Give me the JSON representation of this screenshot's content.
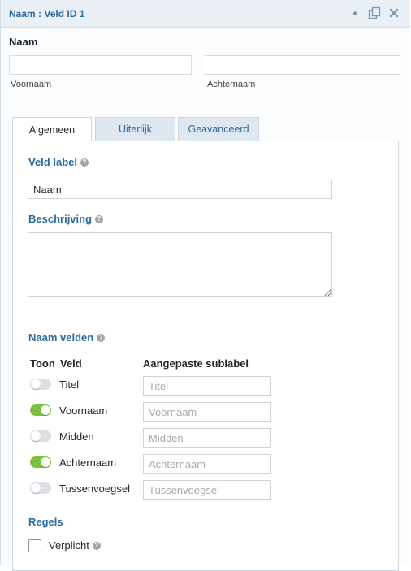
{
  "titlebar": {
    "title": "Naam : Veld ID 1",
    "icons": [
      "collapse-up-icon",
      "duplicate-icon",
      "close-icon"
    ]
  },
  "preview": {
    "label": "Naam",
    "first_sublabel": "Voornaam",
    "last_sublabel": "Achternaam"
  },
  "tabs": [
    {
      "label": "Algemeen",
      "active": true
    },
    {
      "label": "Uiterlijk",
      "active": false
    },
    {
      "label": "Geavanceerd",
      "active": false
    }
  ],
  "general": {
    "field_label_heading": "Veld label",
    "field_label_value": "Naam",
    "description_heading": "Beschrijving",
    "description_value": "",
    "name_fields_heading": "Naam velden",
    "col_show": "Toon",
    "col_field": "Veld",
    "col_custom_sublabel": "Aangepaste sublabel",
    "rows": [
      {
        "label": "Titel",
        "enabled": false,
        "placeholder": "Titel"
      },
      {
        "label": "Voornaam",
        "enabled": true,
        "placeholder": "Voornaam"
      },
      {
        "label": "Midden",
        "enabled": false,
        "placeholder": "Midden"
      },
      {
        "label": "Achternaam",
        "enabled": true,
        "placeholder": "Achternaam"
      },
      {
        "label": "Tussenvoegsel",
        "enabled": false,
        "placeholder": "Tussenvoegsel"
      }
    ],
    "rules_heading": "Regels",
    "required_label": "Verplicht",
    "required_checked": false
  },
  "colors": {
    "accent": "#2b6c9e",
    "toggle_on": "#7ac142",
    "toggle_off": "#dcdfe3"
  }
}
